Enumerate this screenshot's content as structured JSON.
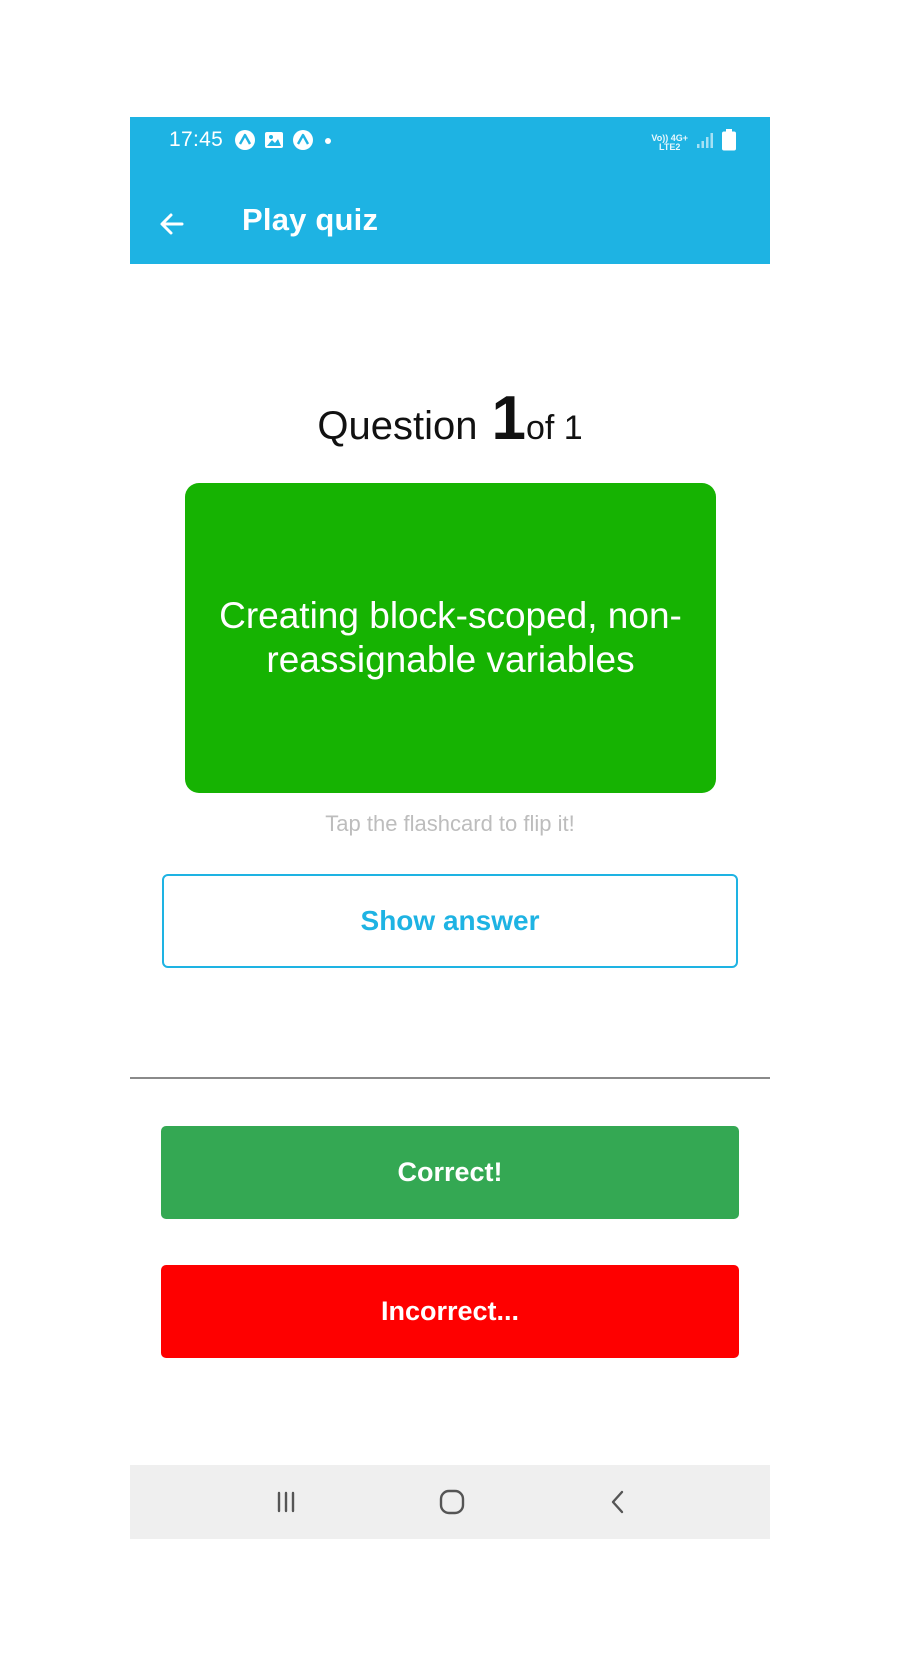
{
  "status_bar": {
    "time": "17:45",
    "left_icons": [
      "app-icon",
      "image-icon",
      "app-icon",
      "dot-icon"
    ],
    "network_top": "Vo)) 4G+",
    "network_bottom": "LTE2",
    "right_icons": [
      "signal-icon",
      "battery-icon"
    ]
  },
  "app_bar": {
    "back_icon": "arrow-left-icon",
    "title": "Play quiz"
  },
  "quiz": {
    "question_label": "Question",
    "current": "1",
    "of_label": "of 1"
  },
  "flashcard": {
    "text": "Creating block-scoped, non-reassignable variables",
    "color": "#16b302"
  },
  "hint": "Tap the flashcard to flip it!",
  "buttons": {
    "show_answer": "Show answer",
    "correct": "Correct!",
    "incorrect": "Incorrect..."
  },
  "colors": {
    "accent": "#1eb3e3",
    "correct": "#34a853",
    "incorrect": "#fe0000"
  },
  "nav_bar": {
    "icons": [
      "recents-icon",
      "home-icon",
      "back-icon"
    ]
  }
}
